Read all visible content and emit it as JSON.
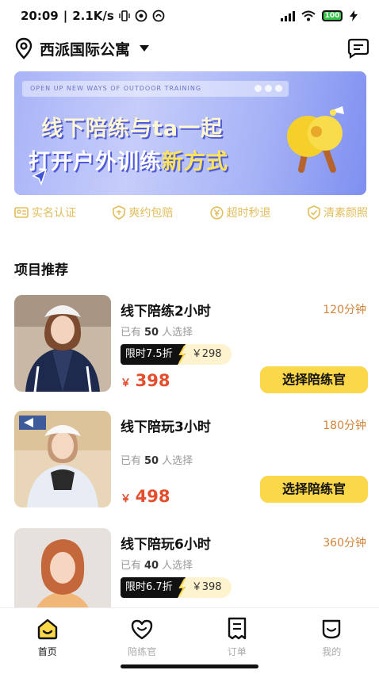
{
  "status_bar": {
    "time": "20:09",
    "speed": "2.1K/s",
    "battery": "100"
  },
  "header": {
    "location": "西派国际公寓"
  },
  "banner": {
    "topbar_text": "OPEN UP NEW WAYS OF OUTDOOR TRAINING",
    "line1": "线下陪练与ta一起",
    "line2_a": "打开户外训练",
    "line2_b": "新方式"
  },
  "features": [
    {
      "label": "实名认证",
      "icon": "id-card-icon"
    },
    {
      "label": "爽约包赔",
      "icon": "shield-icon"
    },
    {
      "label": "超时秒退",
      "icon": "yen-coin-icon"
    },
    {
      "label": "清素颜照",
      "icon": "shield-check-icon"
    }
  ],
  "section_title": "项目推荐",
  "products": [
    {
      "name": "线下陪练2小时",
      "duration": "120分钟",
      "chosen_prefix": "已有",
      "chosen_count": "50",
      "chosen_suffix": "人选择",
      "promo_tag": "限时7.5折",
      "original_price": "￥298",
      "currency": "￥",
      "price": "398",
      "button": "选择陪练官"
    },
    {
      "name": "线下陪玩3小时",
      "duration": "180分钟",
      "chosen_prefix": "已有",
      "chosen_count": "50",
      "chosen_suffix": "人选择",
      "currency": "￥",
      "price": "498",
      "button": "选择陪练官"
    },
    {
      "name": "线下陪玩6小时",
      "duration": "360分钟",
      "chosen_prefix": "已有",
      "chosen_count": "40",
      "chosen_suffix": "人选择",
      "promo_tag": "限时6.7折",
      "original_price": "￥398"
    }
  ],
  "tabs": [
    {
      "label": "首页",
      "icon": "home-icon",
      "active": true
    },
    {
      "label": "陪练官",
      "icon": "heart-smile-icon"
    },
    {
      "label": "订单",
      "icon": "receipt-icon"
    },
    {
      "label": "我的",
      "icon": "profile-smile-icon"
    }
  ],
  "colors": {
    "accent": "#fbd74a",
    "price": "#e44e2d",
    "duration": "#d2843a",
    "feature": "#e2bd5c"
  }
}
